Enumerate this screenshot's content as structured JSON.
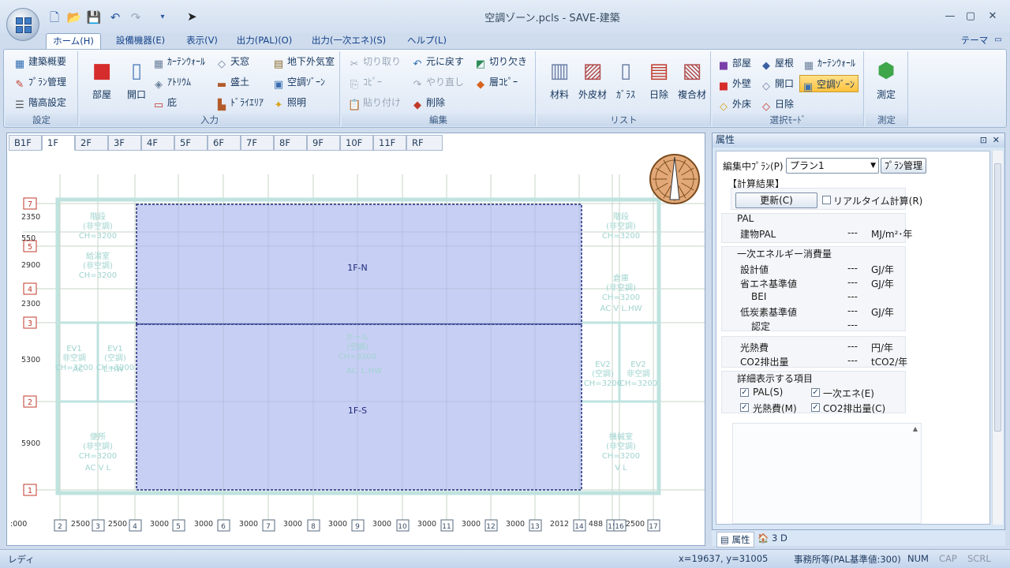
{
  "window": {
    "title": "空調ゾーン.pcls - SAVE-建築"
  },
  "quick_access": [
    "new-icon",
    "open-folder-icon",
    "save-icon",
    "undo-icon",
    "redo-icon",
    "dropdown-arrow-icon"
  ],
  "ribbon_tabs": [
    "ホーム(H)",
    "設備機器(E)",
    "表示(V)",
    "出力(PAL)(O)",
    "出力(一次エネ)(S)",
    "ヘルプ(L)"
  ],
  "theme_label": "テーマ",
  "groups": {
    "settings": {
      "label": "設定",
      "items": [
        "建築概要",
        "ﾌﾟﾗﾝ管理",
        "階高設定"
      ]
    },
    "input": {
      "label": "入力",
      "large": [
        "部屋",
        "開口"
      ],
      "items": [
        "ｶｰﾃﾝｳｫｰﾙ",
        "天窓",
        "地下外気室",
        "ｱﾄﾘｳﾑ",
        "盛土",
        "空調ｿﾞｰﾝ",
        "庇",
        "ﾄﾞﾗｲｴﾘｱ",
        "照明"
      ]
    },
    "edit": {
      "label": "編集",
      "items": [
        "切り取り",
        "元に戻す",
        "切り欠き",
        "ｺﾋﾟｰ",
        "やり直し",
        "層ｺﾋﾟｰ",
        "貼り付け",
        "削除"
      ]
    },
    "list": {
      "label": "リスト",
      "items": [
        "材料",
        "外皮材",
        "ｶﾞﾗｽ",
        "日除",
        "複合材"
      ]
    },
    "select_mode": {
      "label": "選択ﾓｰﾄﾞ",
      "items": [
        "部屋",
        "屋根",
        "ｶｰﾃﾝｳｫｰﾙ",
        "外壁",
        "開口",
        "空調ｿﾞｰﾝ",
        "外床",
        "日除"
      ]
    },
    "measure": {
      "label": "測定",
      "items": [
        "測定"
      ]
    }
  },
  "floor_tabs": [
    "B1F",
    "1F",
    "2F",
    "3F",
    "4F",
    "5F",
    "6F",
    "7F",
    "8F",
    "9F",
    "10F",
    "11F",
    "RF"
  ],
  "active_floor": "1F",
  "plan": {
    "zones": [
      "1F-N",
      "1F-S"
    ],
    "row_markers": [
      "7",
      "5",
      "4",
      "3",
      "2",
      "1"
    ],
    "row_dims": [
      "2350",
      "550",
      "2900",
      "2300",
      "5300",
      "5900"
    ],
    "col_markers": [
      "2",
      "3",
      "4",
      "5",
      "6",
      "7",
      "8",
      "9",
      "10",
      "11",
      "12",
      "13",
      "14",
      "15",
      "16",
      "17"
    ],
    "col_dims": [
      "2500",
      "2500",
      "3000",
      "3000",
      "3000",
      "3000",
      "3000",
      "3000",
      "3000",
      "3000",
      "3000",
      "2012",
      "488",
      "2500"
    ],
    "left_dim": ":000",
    "room_labels": [
      "階段",
      "(非空調)",
      "CH=3200",
      "給湯室",
      "(非空調)",
      "CH=3200",
      "EV1",
      "非空調",
      "CH=3200",
      "EV1",
      "(空調)",
      "CH=3200",
      "便所",
      "(非空調)",
      "CH=3200",
      "ホール",
      "(空調)",
      "CH=3200",
      "階段",
      "(非空調)",
      "CH=3200",
      "倉庫",
      "(非空調)",
      "CH=3200",
      "EV2",
      "(空調)",
      "CH=3200",
      "EV2",
      "非空調",
      "CH=3200",
      "機械室",
      "(非空調)",
      "CH=3200",
      "AC",
      "L.HW",
      "AC",
      "L.HW",
      "AC V L",
      "AC V L.HW",
      "V L"
    ]
  },
  "properties": {
    "title": "属性",
    "plan_label": "編集中ﾌﾟﾗﾝ(P)",
    "plan_value": "プラン1",
    "plan_manage": "ﾌﾟﾗﾝ管理",
    "calc_result": "【計算結果】",
    "update_btn": "更新(C)",
    "realtime": "リアルタイム計算(R)",
    "pal_head": "PAL",
    "building_pal": {
      "label": "建物PAL",
      "value": "---",
      "unit": "MJ/m²･年"
    },
    "energy_head": "一次エネルギー消費量",
    "energy_rows": [
      {
        "label": "設計値",
        "value": "---",
        "unit": "GJ/年"
      },
      {
        "label": "省エネ基準値",
        "value": "---",
        "unit": "GJ/年"
      },
      {
        "label": "BEI",
        "value": "---",
        "unit": ""
      },
      {
        "label": "低炭素基準値",
        "value": "---",
        "unit": "GJ/年"
      },
      {
        "label": "認定",
        "value": "---",
        "unit": ""
      }
    ],
    "cost": {
      "label": "光熱費",
      "value": "---",
      "unit": "円/年"
    },
    "co2": {
      "label": "CO2排出量",
      "value": "---",
      "unit": "tCO2/年"
    },
    "detail_head": "詳細表示する項目",
    "checks": [
      "PAL(S)",
      "一次エネ(E)",
      "光熱費(M)",
      "CO2排出量(C)"
    ]
  },
  "panel_tabs": [
    "属性",
    "3 D"
  ],
  "status": {
    "left": "レディ",
    "coords": "x=19637, y=31005",
    "usage": "事務所等(PAL基準値:300)",
    "num": "NUM",
    "cap": "CAP",
    "scrl": "SCRL"
  },
  "colors": {
    "zone_fill": "#aab6ee",
    "grid_line": "#c7d6c7",
    "wall": "#bfe3df",
    "marker_red": "#c0392b",
    "ribbon_active": "#ffc23d"
  }
}
